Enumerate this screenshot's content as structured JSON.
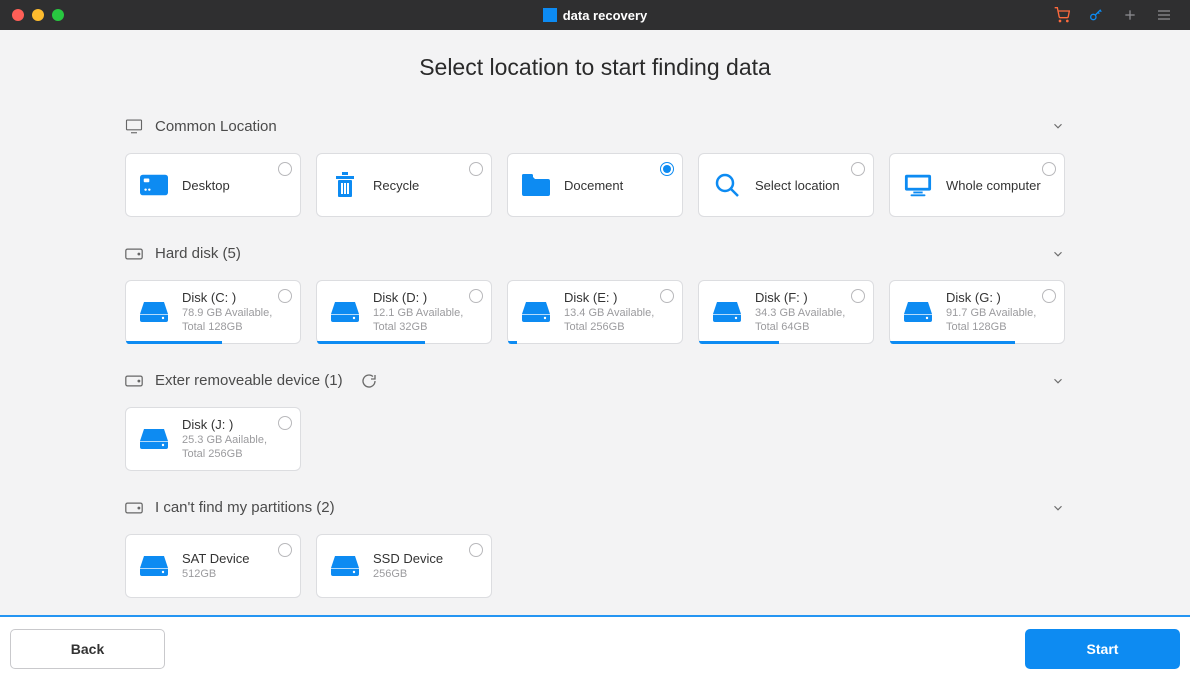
{
  "colors": {
    "accent": "#0d8bf2"
  },
  "titlebar": {
    "title": "data recovery"
  },
  "headline": "Select location to  start finding data",
  "sections": {
    "common": {
      "title": "Common Location",
      "items": [
        {
          "id": "desktop",
          "label": "Desktop",
          "selected": false
        },
        {
          "id": "recycle",
          "label": "Recycle",
          "selected": false
        },
        {
          "id": "document",
          "label": "Docement",
          "selected": true
        },
        {
          "id": "select-location",
          "label": "Select location",
          "selected": false
        },
        {
          "id": "whole-computer",
          "label": "Whole computer",
          "selected": false
        }
      ]
    },
    "hard_disk": {
      "title": "Hard disk (5)",
      "items": [
        {
          "id": "disk-c",
          "label": "Disk (C: )",
          "sub": "78.9 GB Available, Total 128GB",
          "progress_pct": 55
        },
        {
          "id": "disk-d",
          "label": "Disk (D: )",
          "sub": "12.1 GB Available, Total 32GB",
          "progress_pct": 62
        },
        {
          "id": "disk-e",
          "label": "Disk (E: )",
          "sub": "13.4 GB Available, Total 256GB",
          "progress_pct": 5
        },
        {
          "id": "disk-f",
          "label": "Disk (F: )",
          "sub": "34.3 GB Available, Total 64GB",
          "progress_pct": 46
        },
        {
          "id": "disk-g",
          "label": "Disk (G: )",
          "sub": "91.7 GB Available, Total 128GB",
          "progress_pct": 72
        }
      ]
    },
    "removable": {
      "title": "Exter removeable device (1)",
      "items": [
        {
          "id": "disk-j",
          "label": "Disk (J: )",
          "sub": "25.3 GB Aailable, Total 256GB",
          "progress_pct": 0
        }
      ]
    },
    "partitions": {
      "title": "I can't find my partitions (2)",
      "items": [
        {
          "id": "sat-device",
          "label": "SAT Device",
          "sub": "512GB"
        },
        {
          "id": "ssd-device",
          "label": "SSD Device",
          "sub": "256GB"
        }
      ]
    }
  },
  "footer": {
    "back": "Back",
    "start": "Start"
  }
}
